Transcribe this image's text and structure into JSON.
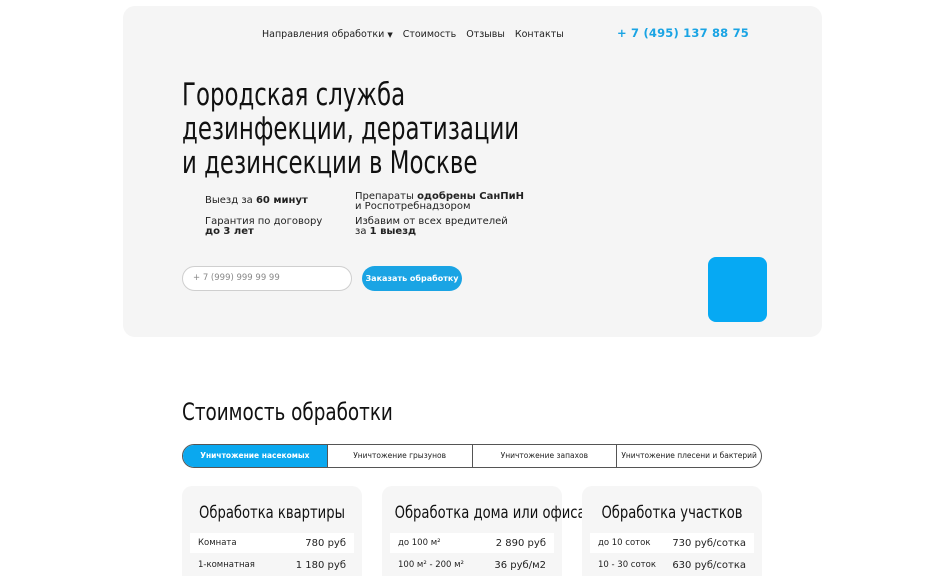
{
  "nav": {
    "items": [
      {
        "label": "Направления обработки",
        "has_dropdown": true
      },
      {
        "label": "Стоимость"
      },
      {
        "label": "Отзывы"
      },
      {
        "label": "Контакты"
      }
    ],
    "phone": "+ 7 (495) 137 88 75"
  },
  "hero": {
    "title_lines": [
      "Городская служба",
      "дезинфекции, дератизации",
      "и дезинсекции в Москве"
    ],
    "features": [
      {
        "pre": "Выезд за ",
        "bold": "60 минут",
        "post": ""
      },
      {
        "pre": "Препараты ",
        "bold": "одобрены СанПиН",
        "post": "и Роспотребнадзором"
      },
      {
        "pre": "Гарантия по договору",
        "bold": "до 3 лет",
        "post": ""
      },
      {
        "pre": "Избавим от всех вредителей",
        "bold": "1 выезд",
        "prefix2": "за "
      }
    ],
    "phone_placeholder": "+ 7 (999) 999 99 99",
    "order_button": "Заказать обработку"
  },
  "pricing": {
    "title": "Стоимость обработки",
    "tabs": [
      {
        "label": "Уничтожение насекомых",
        "active": true
      },
      {
        "label": "Уничтожение грызунов",
        "active": false
      },
      {
        "label": "Уничтожение запахов",
        "active": false
      },
      {
        "label": "Уничтожение плесени и бактерий",
        "active": false
      }
    ],
    "cards": [
      {
        "title": "Обработка квартиры",
        "rows": [
          {
            "name": "Комната",
            "price": "780 руб"
          },
          {
            "name": "1-комнатная",
            "price": "1 180 руб"
          }
        ]
      },
      {
        "title": "Обработка дома или офиса",
        "rows": [
          {
            "name": "до 100 м²",
            "price": "2 890 руб"
          },
          {
            "name": "100 м² - 200 м²",
            "price": "36 руб/м2"
          }
        ]
      },
      {
        "title": "Обработка участков",
        "rows": [
          {
            "name": "до 10 соток",
            "price": "730 руб/сотка"
          },
          {
            "name": "10 - 30 соток",
            "price": "630 руб/сотка"
          }
        ]
      }
    ]
  },
  "colors": {
    "accent": "#1aa4e4",
    "tile": "#06a9f3"
  }
}
